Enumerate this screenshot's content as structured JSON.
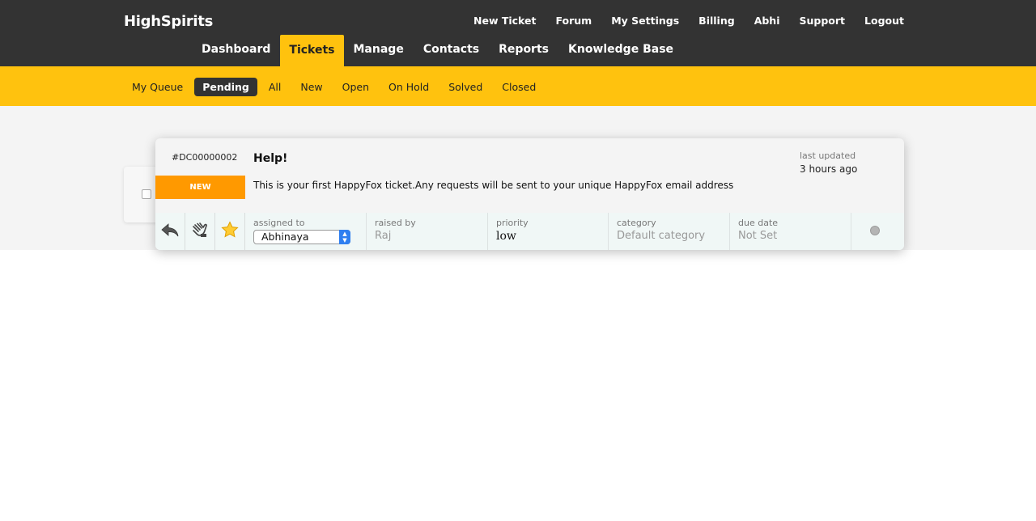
{
  "brand": "HighSpirits",
  "top_links": [
    "New Ticket",
    "Forum",
    "My Settings",
    "Billing",
    "Abhi",
    "Support",
    "Logout"
  ],
  "main_nav": [
    {
      "label": "Dashboard",
      "active": false
    },
    {
      "label": "Tickets",
      "active": true
    },
    {
      "label": "Manage",
      "active": false
    },
    {
      "label": "Contacts",
      "active": false
    },
    {
      "label": "Reports",
      "active": false
    },
    {
      "label": "Knowledge Base",
      "active": false
    }
  ],
  "sub_nav": [
    {
      "label": "My Queue",
      "active": false
    },
    {
      "label": "Pending",
      "active": true
    },
    {
      "label": "All",
      "active": false
    },
    {
      "label": "New",
      "active": false
    },
    {
      "label": "Open",
      "active": false
    },
    {
      "label": "On Hold",
      "active": false
    },
    {
      "label": "Solved",
      "active": false
    },
    {
      "label": "Closed",
      "active": false
    }
  ],
  "ticket": {
    "id": "#DC00000002",
    "status": "NEW",
    "subject": "Help!",
    "preview": "This is your first HappyFox ticket.Any requests will be sent to your unique HappyFox email address",
    "last_updated_label": "last updated",
    "last_updated_value": "3 hours ago",
    "icons": [
      "reply-icon",
      "grab-hand-icon",
      "star-icon"
    ],
    "assigned_to": {
      "label": "assigned to",
      "value": "Abhinaya"
    },
    "raised_by": {
      "label": "raised by",
      "value": "Raj"
    },
    "priority": {
      "label": "priority",
      "value": "low"
    },
    "category": {
      "label": "category",
      "value": "Default category"
    },
    "due_date": {
      "label": "due date",
      "value": "Not Set"
    }
  },
  "colors": {
    "topbar": "#333333",
    "accent_yellow": "#ffc20e",
    "status_orange": "#ff9900",
    "select_blue": "#2f7ff0"
  }
}
